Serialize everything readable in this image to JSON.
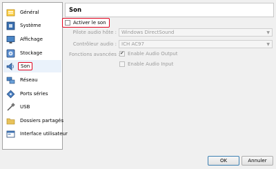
{
  "sidebar": {
    "items": [
      {
        "label": "Général",
        "icon": "general-icon"
      },
      {
        "label": "Système",
        "icon": "system-icon"
      },
      {
        "label": "Affichage",
        "icon": "display-icon"
      },
      {
        "label": "Stockage",
        "icon": "storage-icon"
      },
      {
        "label": "Son",
        "icon": "audio-icon",
        "selected": true
      },
      {
        "label": "Réseau",
        "icon": "network-icon"
      },
      {
        "label": "Ports séries",
        "icon": "serial-ports-icon"
      },
      {
        "label": "USB",
        "icon": "usb-icon"
      },
      {
        "label": "Dossiers partagés",
        "icon": "shared-folders-icon"
      },
      {
        "label": "Interface utilisateur",
        "icon": "user-interface-icon"
      }
    ]
  },
  "page": {
    "title": "Son"
  },
  "audio": {
    "enable_label": "Activer le son",
    "enabled": false,
    "host_driver_label": "Pilote audio hôte :",
    "host_driver_value": "Windows DirectSound",
    "controller_label": "Contrôleur audio :",
    "controller_value": "ICH AC97",
    "advanced_label": "Fonctions avancées :",
    "enable_output_label": "Enable Audio Output",
    "enable_output_checked": true,
    "enable_input_label": "Enable Audio Input",
    "enable_input_checked": false
  },
  "buttons": {
    "ok": "OK",
    "cancel": "Annuler"
  },
  "colors": {
    "highlight": "#e0001b",
    "disabled_text": "#9a9a9a"
  }
}
